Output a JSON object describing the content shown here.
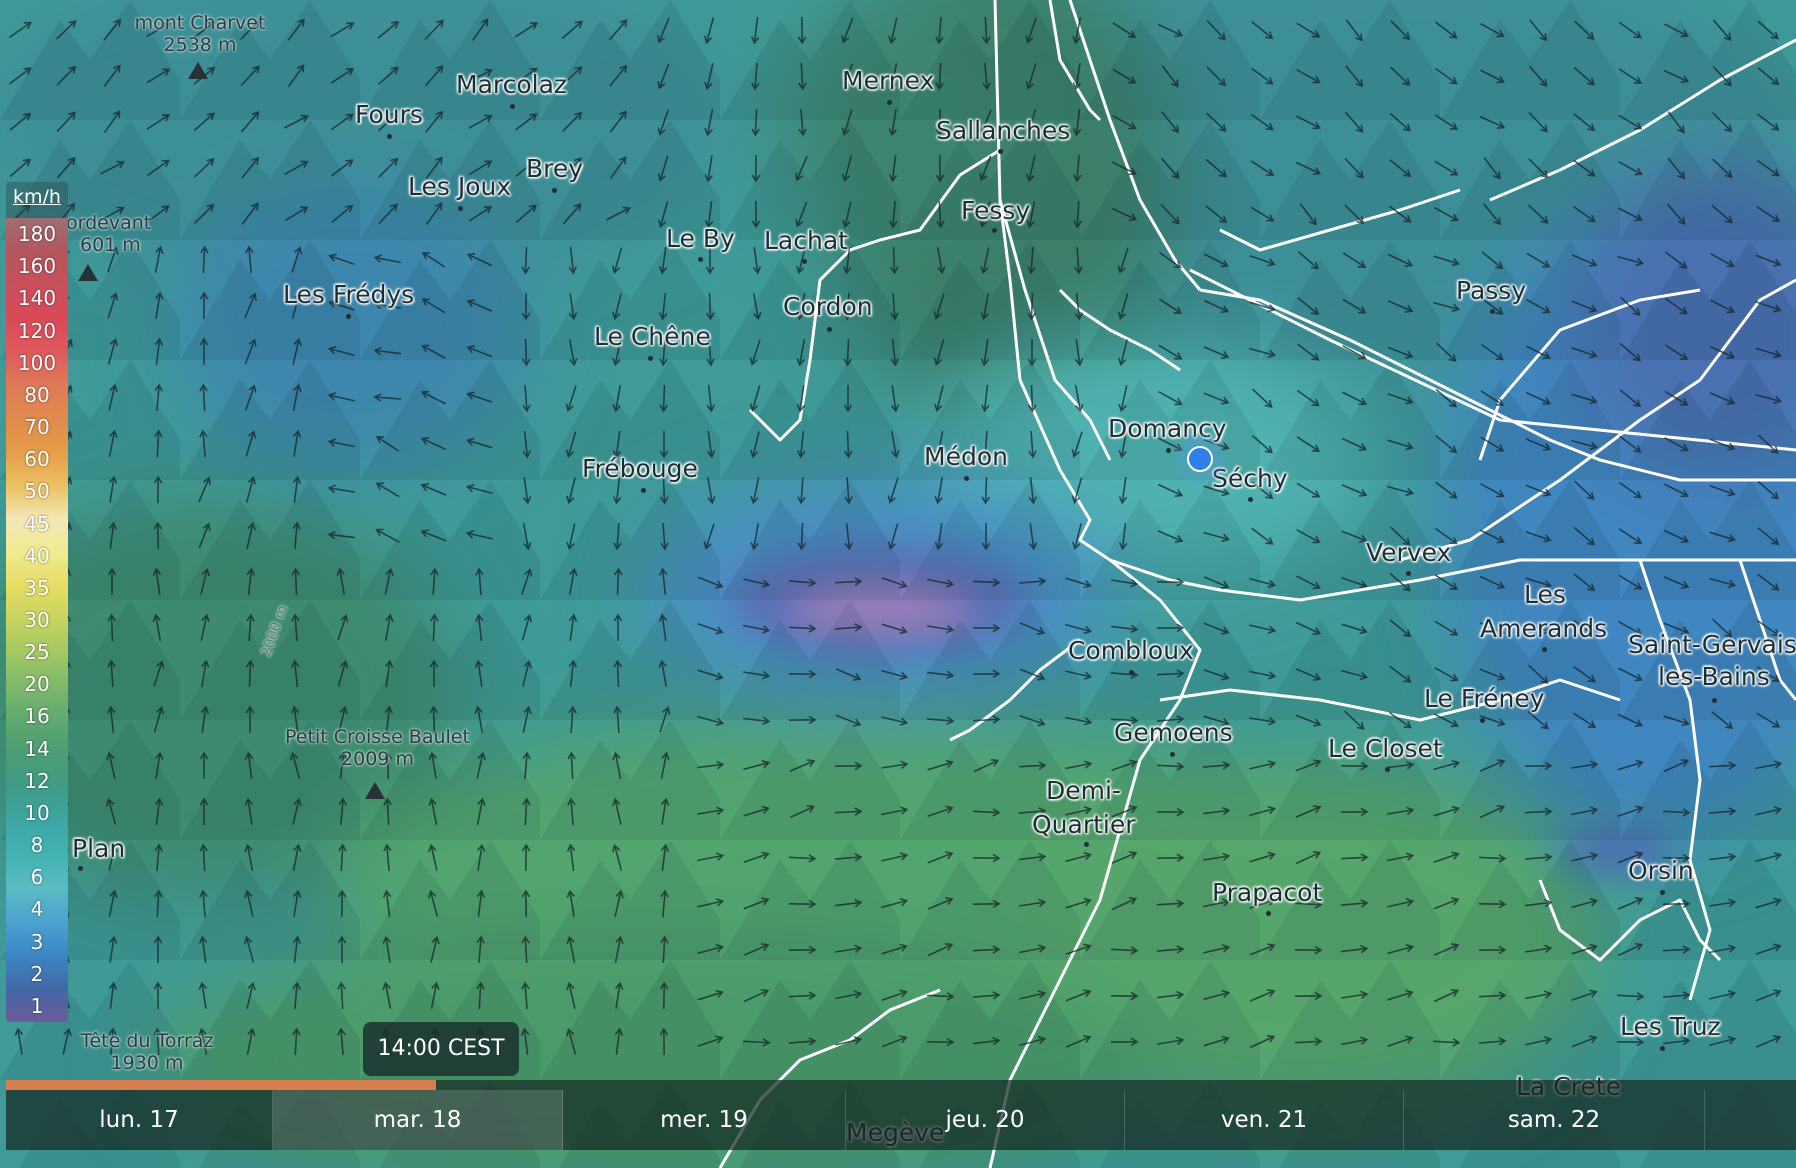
{
  "legend": {
    "unit": "km/h",
    "labels": [
      "180",
      "160",
      "140",
      "120",
      "100",
      "80",
      "70",
      "60",
      "50",
      "45",
      "40",
      "35",
      "30",
      "25",
      "20",
      "16",
      "14",
      "12",
      "10",
      "8",
      "6",
      "4",
      "3",
      "2",
      "1"
    ],
    "colors": [
      "#9d6f72",
      "#b3565e",
      "#c9505b",
      "#d94a57",
      "#dd5a5e",
      "#df7a58",
      "#e08a4c",
      "#e59e4a",
      "#ecc162",
      "#f3e6b7",
      "#f0eb8f",
      "#e5dc63",
      "#c7d45f",
      "#a2c764",
      "#7db86b",
      "#5fa86f",
      "#4b9d74",
      "#3f9c87",
      "#3ea5a5",
      "#43b2b2",
      "#5bbcc4",
      "#4ca2d0",
      "#3d86c5",
      "#4369a7",
      "#6a5a9a"
    ]
  },
  "places": [
    {
      "name": "Marcolaz"
    },
    {
      "name": "Fours"
    },
    {
      "name": "Brey"
    },
    {
      "name": "Les Joux"
    },
    {
      "name": "Les Frédys"
    },
    {
      "name": "Le By"
    },
    {
      "name": "Lachat"
    },
    {
      "name": "Cordon"
    },
    {
      "name": "Le Chêne"
    },
    {
      "name": "Mernex"
    },
    {
      "name": "Sallanches"
    },
    {
      "name": "Fessy"
    },
    {
      "name": "Passy"
    },
    {
      "name": "Domancy"
    },
    {
      "name": "Séchy"
    },
    {
      "name": "Médon"
    },
    {
      "name": "Frébouge"
    },
    {
      "name": "Vervex"
    },
    {
      "name": "Les"
    },
    {
      "name": "Amerands"
    },
    {
      "name": "Saint-Gervais-"
    },
    {
      "name": "les-Bains"
    },
    {
      "name": "Combloux"
    },
    {
      "name": "Le Fréney"
    },
    {
      "name": "Gemoens"
    },
    {
      "name": "Le Closet"
    },
    {
      "name": "Demi-"
    },
    {
      "name": "Quartier"
    },
    {
      "name": "Prapacot"
    },
    {
      "name": "Orsin"
    },
    {
      "name": "Plan"
    },
    {
      "name": "Les Truz"
    },
    {
      "name": "La Crete"
    },
    {
      "name": "Megève"
    }
  ],
  "peaks": [
    {
      "name": "mont Charvet",
      "elevation": "2538 m"
    },
    {
      "name": "ordevant",
      "elevation": "601 m"
    },
    {
      "name": "Petit Croisse Baulet",
      "elevation": "2009 m"
    },
    {
      "name": "Tête du Torraz",
      "elevation": "1930 m"
    }
  ],
  "contour_label": "2000 m",
  "time_badge": "14:00 CEST",
  "timeline": {
    "days": [
      "lun. 17",
      "mar. 18",
      "mer. 19",
      "jeu. 20",
      "ven. 21",
      "sam. 22"
    ],
    "selected": 1,
    "progress": 0.24
  },
  "marker": {
    "icon": "location-dot-icon"
  }
}
